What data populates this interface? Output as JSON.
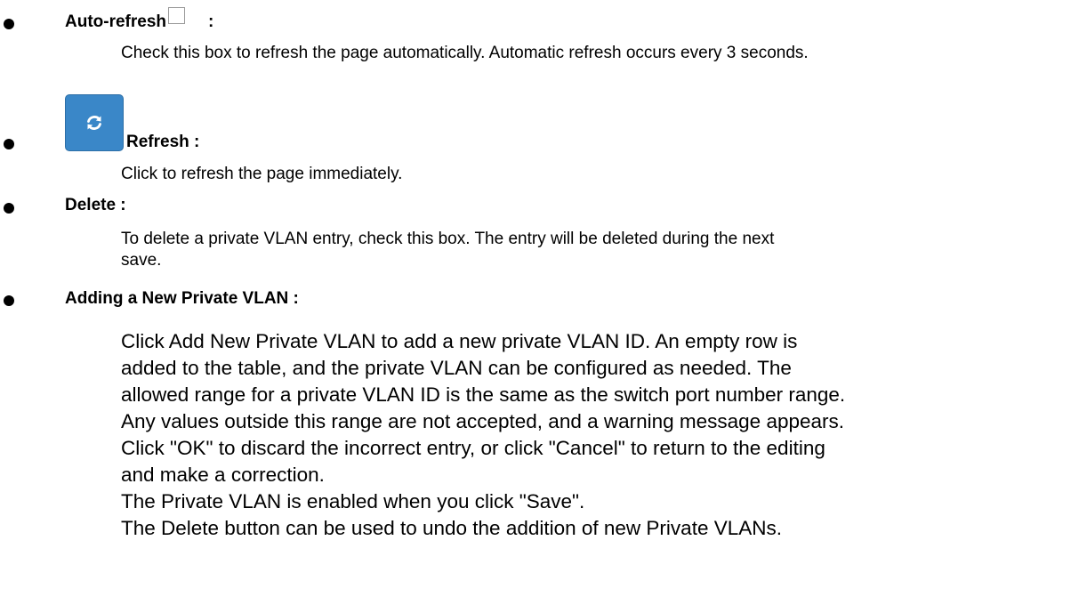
{
  "items": [
    {
      "heading": "Auto-refresh",
      "colon": ":",
      "desc": "Check this box to refresh the page automatically. Automatic refresh occurs every 3 seconds."
    },
    {
      "heading": "Refresh :",
      "desc": "Click to refresh the page immediately.",
      "icon": "refresh-icon"
    },
    {
      "heading": "Delete :",
      "desc_lines": [
        "To delete a private VLAN entry, check this box. The entry will be deleted during the next",
        "save."
      ]
    },
    {
      "heading": "Adding a New Private VLAN :",
      "desc_lines": [
        "Click Add New Private VLAN to add a new private VLAN ID. An empty row is",
        "added to the table, and the private VLAN can be configured as needed. The",
        "allowed range for a private VLAN ID is the same as the switch port number range.",
        "Any values outside this range are not accepted, and a warning message appears.",
        "Click \"OK\" to discard the incorrect entry, or click \"Cancel\" to return to the editing",
        "and make a correction.",
        "The Private VLAN is enabled when you click \"Save\".",
        "The Delete button can be used to undo the addition of new Private VLANs."
      ]
    }
  ],
  "colors": {
    "button_bg": "#3a87c8",
    "button_border": "#2c6ea6",
    "checkbox_border": "#9a9a9a"
  }
}
